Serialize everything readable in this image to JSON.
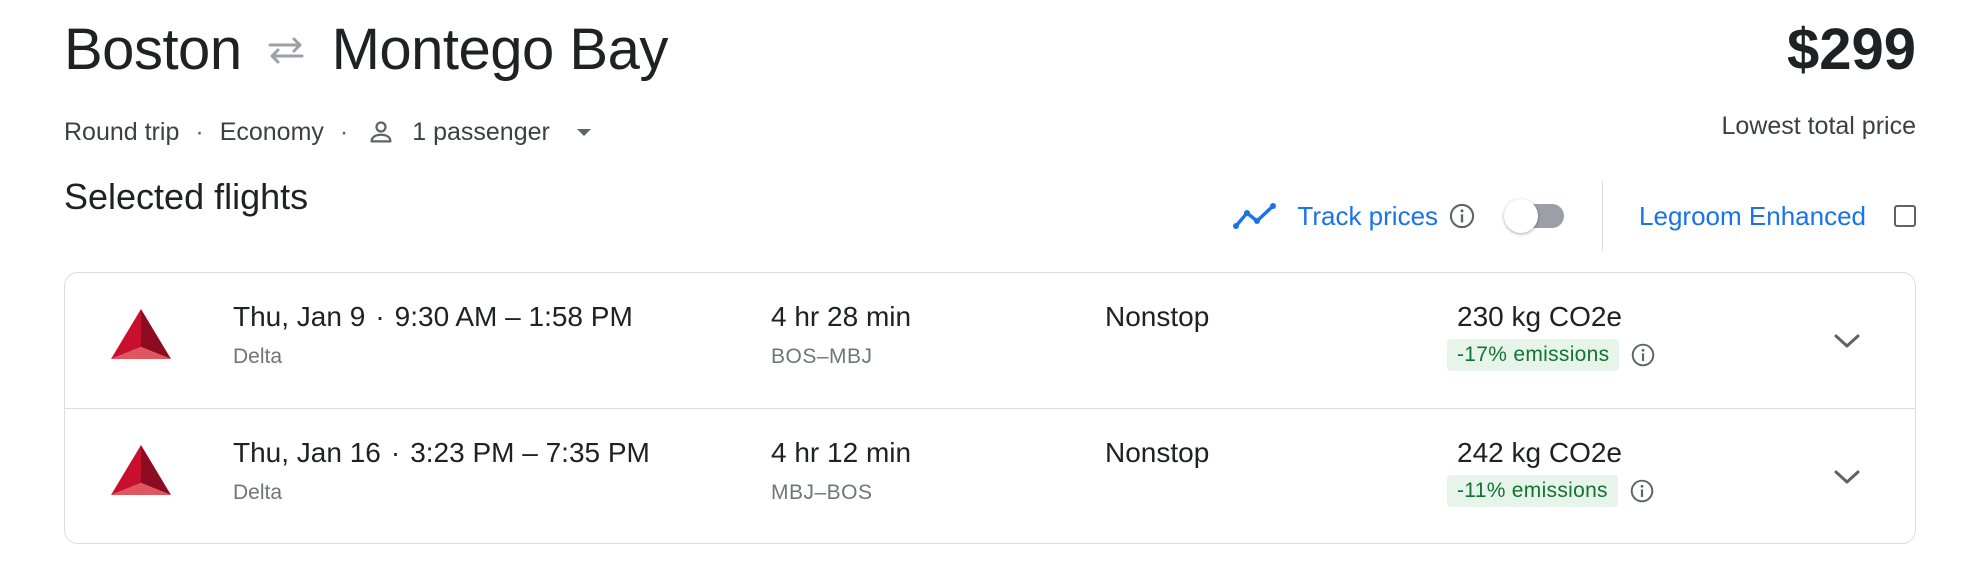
{
  "trip": {
    "origin": "Boston",
    "destination": "Montego Bay",
    "trip_type": "Round trip",
    "cabin": "Economy",
    "passengers": "1 passenger",
    "separator": "·"
  },
  "price": {
    "amount": "$299",
    "label": "Lowest total price"
  },
  "section": {
    "title": "Selected flights"
  },
  "controls": {
    "track_prices_label": "Track prices",
    "track_prices_on": false,
    "legroom_label": "Legroom Enhanced",
    "legroom_checked": false
  },
  "flights": [
    {
      "date": "Thu, Jan 9",
      "times": "9:30 AM – 1:58 PM",
      "airline": "Delta",
      "duration": "4 hr 28 min",
      "airports": "BOS–MBJ",
      "stops": "Nonstop",
      "co2": "230 kg CO2e",
      "emissions": "-17% emissions"
    },
    {
      "date": "Thu, Jan 16",
      "times": "3:23 PM – 7:35 PM",
      "airline": "Delta",
      "duration": "4 hr 12 min",
      "airports": "MBJ–BOS",
      "stops": "Nonstop",
      "co2": "242 kg CO2e",
      "emissions": "-11% emissions"
    }
  ],
  "icons": {
    "swap": "swap-arrows-icon",
    "person": "person-icon",
    "caret": "caret-down-icon",
    "trend": "trending-line-icon",
    "info": "info-icon",
    "chevron": "chevron-down-icon",
    "airline_logo": "delta-logo"
  },
  "colors": {
    "accent": "#1a73e8",
    "emissions_bg": "#e6f4ea",
    "emissions_text": "#137333",
    "delta_red": "#c8102e"
  }
}
